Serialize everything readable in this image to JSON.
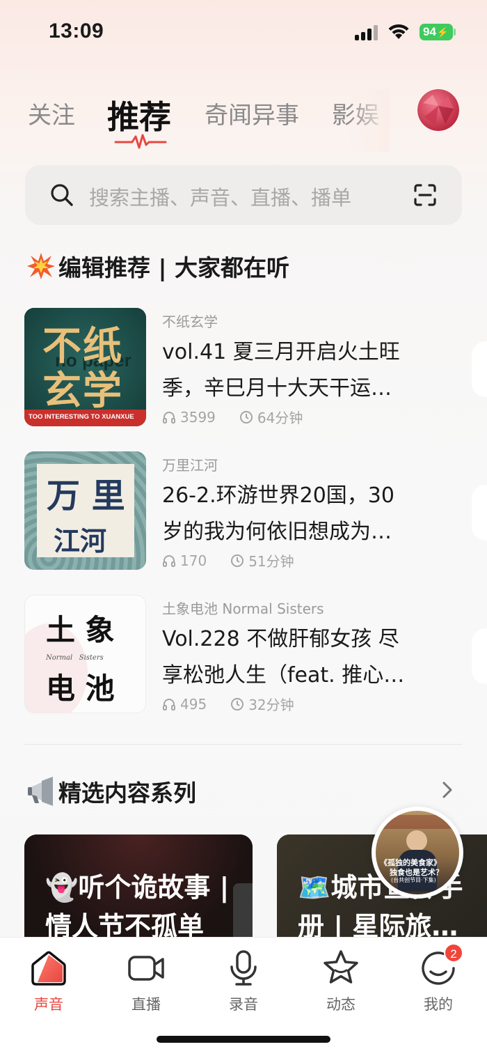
{
  "status_bar": {
    "time": "13:09",
    "battery": "94"
  },
  "tabs": [
    {
      "label": "关注",
      "active": false
    },
    {
      "label": "推荐",
      "active": true
    },
    {
      "label": "奇闻异事",
      "active": false
    },
    {
      "label": "影娱",
      "active": false
    }
  ],
  "search": {
    "placeholder": "搜索主播、声音、直播、播单"
  },
  "editor_section": {
    "title": "编辑推荐 | 大家都在听"
  },
  "editor_items": [
    {
      "author": "不纸玄学",
      "title_line1": "vol.41 夏三月开启火土旺",
      "title_line2": "季，辛巳月十大天干运…",
      "plays": "3599",
      "duration": "64分钟",
      "cover_text1": "不纸",
      "cover_text2": "玄学",
      "cover_sub": "TOO INTERESTING TO XUANXUE",
      "cover_wm": "no paper"
    },
    {
      "author": "万里江河",
      "title_line1": "26-2.环游世界20国，30",
      "title_line2": "岁的我为何依旧想成为…",
      "plays": "170",
      "duration": "51分钟",
      "cover_text1": "万 里",
      "cover_text2": "江河"
    },
    {
      "author": "土象电池 Normal Sisters",
      "title_line1": "Vol.228 不做肝郁女孩 尽",
      "title_line2": "享松弛人生（feat. 推心…",
      "plays": "495",
      "duration": "32分钟",
      "cover_text1": "土 象",
      "cover_text2": "电 池",
      "cover_sub": "Normal   Sisters"
    }
  ],
  "series_section": {
    "title": "精选内容系列"
  },
  "series_cards": [
    {
      "line1": "👻听个诡故事 |",
      "line2": "情人节不孤单"
    },
    {
      "line1": "🗺️城市宣传手",
      "line2": "册 | 星际旅…"
    }
  ],
  "float_bubble": {
    "text1": "《孤独的美食家》",
    "text2": "独食也是艺术？",
    "text3": "(台共创节目·下集)"
  },
  "bottom_nav": [
    {
      "label": "声音",
      "active": true
    },
    {
      "label": "直播",
      "active": false
    },
    {
      "label": "录音",
      "active": false
    },
    {
      "label": "动态",
      "active": false
    },
    {
      "label": "我的",
      "active": false,
      "badge": "2"
    }
  ],
  "colors": {
    "accent": "#e8473f",
    "badge": "#f0453b",
    "battery": "#3ccb5c"
  }
}
